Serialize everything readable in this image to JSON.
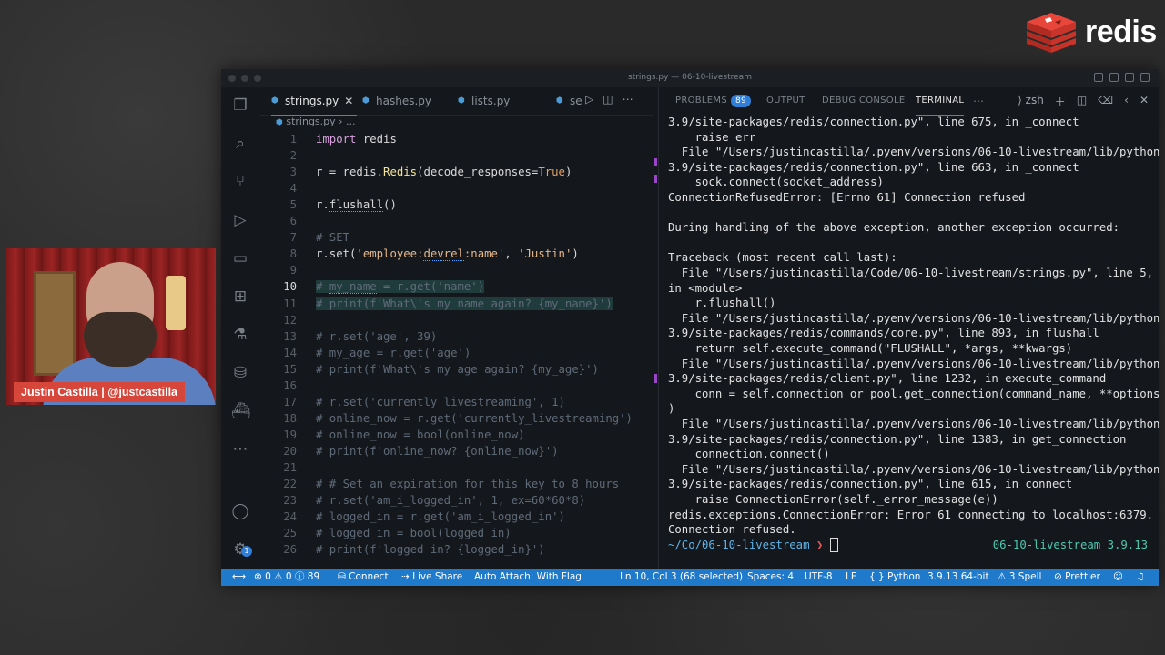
{
  "brand": {
    "name": "redis"
  },
  "window": {
    "title": "strings.py — 06-10-livestream"
  },
  "tabs": [
    {
      "label": "strings.py",
      "active": true
    },
    {
      "label": "hashes.py",
      "active": false
    },
    {
      "label": "lists.py",
      "active": false
    },
    {
      "label": "se",
      "active": false
    }
  ],
  "breadcrumb": {
    "file": "strings.py",
    "sep": "›",
    "rest": "..."
  },
  "editor": {
    "current_line": 10,
    "lines": [
      {
        "n": "1",
        "html": "<span class='kw'>import</span> redis"
      },
      {
        "n": "2",
        "html": ""
      },
      {
        "n": "3",
        "html": "r = redis.<span class='fn'>Redis</span>(decode_responses=<span class='bool'>True</span>)"
      },
      {
        "n": "4",
        "html": ""
      },
      {
        "n": "5",
        "html": "r.<span class='squig'>flushall</span>()"
      },
      {
        "n": "6",
        "html": ""
      },
      {
        "n": "7",
        "html": "<span class='cm'># SET</span>"
      },
      {
        "n": "8",
        "html": "r.set(<span class='str'>'employee:<span class=\"squig\">devrel</span>:name'</span>, <span class='str'>'Justin'</span>)"
      },
      {
        "n": "9",
        "html": ""
      },
      {
        "n": "10",
        "html": "<span class='cm sel'># <span class='squig'>my_name</span> = r.get('name')</span>"
      },
      {
        "n": "11",
        "html": "<span class='cm sel'># print(f'What\\'s my name again? {my_name}')</span>"
      },
      {
        "n": "12",
        "html": ""
      },
      {
        "n": "13",
        "html": "<span class='cm'># r.set('age', 39)</span>"
      },
      {
        "n": "14",
        "html": "<span class='cm'># my_age = r.get('age')</span>"
      },
      {
        "n": "15",
        "html": "<span class='cm'># print(f'What\\'s my age again? {my_age}')</span>"
      },
      {
        "n": "16",
        "html": ""
      },
      {
        "n": "17",
        "html": "<span class='cm'># r.set('currently_livestreaming', 1)</span>"
      },
      {
        "n": "18",
        "html": "<span class='cm'># online_now = r.get('currently_livestreaming')</span>"
      },
      {
        "n": "19",
        "html": "<span class='cm'># online_now = bool(online_now)</span>"
      },
      {
        "n": "20",
        "html": "<span class='cm'># print(f'online_now? {online_now}')</span>"
      },
      {
        "n": "21",
        "html": ""
      },
      {
        "n": "22",
        "html": "<span class='cm'># # Set an expiration for this key to 8 hours</span>"
      },
      {
        "n": "23",
        "html": "<span class='cm'># r.set('am_i_logged_in', 1, ex=60*60*8)</span>"
      },
      {
        "n": "24",
        "html": "<span class='cm'># logged_in = r.get('am_i_logged_in')</span>"
      },
      {
        "n": "25",
        "html": "<span class='cm'># logged_in = bool(logged_in)</span>"
      },
      {
        "n": "26",
        "html": "<span class='cm'># print(f'logged in? {logged_in}')</span>"
      }
    ]
  },
  "panel": {
    "tabs": [
      "PROBLEMS",
      "OUTPUT",
      "DEBUG CONSOLE",
      "TERMINAL"
    ],
    "problems_count": "89",
    "shell": "zsh",
    "terminal_lines": [
      "3.9/site-packages/redis/connection.py\", line 675, in _connect",
      "    raise err",
      "  File \"/Users/justincastilla/.pyenv/versions/06-10-livestream/lib/python",
      "3.9/site-packages/redis/connection.py\", line 663, in _connect",
      "    sock.connect(socket_address)",
      "ConnectionRefusedError: [Errno 61] Connection refused",
      "",
      "During handling of the above exception, another exception occurred:",
      "",
      "Traceback (most recent call last):",
      "  File \"/Users/justincastilla/Code/06-10-livestream/strings.py\", line 5,",
      "in <module>",
      "    r.flushall()",
      "  File \"/Users/justincastilla/.pyenv/versions/06-10-livestream/lib/python",
      "3.9/site-packages/redis/commands/core.py\", line 893, in flushall",
      "    return self.execute_command(\"FLUSHALL\", *args, **kwargs)",
      "  File \"/Users/justincastilla/.pyenv/versions/06-10-livestream/lib/python",
      "3.9/site-packages/redis/client.py\", line 1232, in execute_command",
      "    conn = self.connection or pool.get_connection(command_name, **options",
      ")",
      "  File \"/Users/justincastilla/.pyenv/versions/06-10-livestream/lib/python",
      "3.9/site-packages/redis/connection.py\", line 1383, in get_connection",
      "    connection.connect()",
      "  File \"/Users/justincastilla/.pyenv/versions/06-10-livestream/lib/python",
      "3.9/site-packages/redis/connection.py\", line 615, in connect",
      "    raise ConnectionError(self._error_message(e))",
      "redis.exceptions.ConnectionError: Error 61 connecting to localhost:6379.",
      "Connection refused."
    ],
    "prompt": {
      "dir": "~/Co/06-10-livestream",
      "arrow": "❯",
      "right": "06-10-livestream 3.9.13"
    }
  },
  "status": {
    "errors": "0",
    "warnings": "0",
    "info": "89",
    "connect": "Connect",
    "live_share": "Live Share",
    "auto_attach": "Auto Attach: With Flag",
    "position": "Ln 10, Col 3 (68 selected)",
    "spaces": "Spaces: 4",
    "encoding": "UTF-8",
    "eol": "LF",
    "language": "Python",
    "interpreter": "3.9.13 64-bit",
    "spell": "3 Spell",
    "prettier": "Prettier"
  },
  "webcam": {
    "name_tag": "Justin Castilla | @justcastilla"
  },
  "settings_badge": "1"
}
